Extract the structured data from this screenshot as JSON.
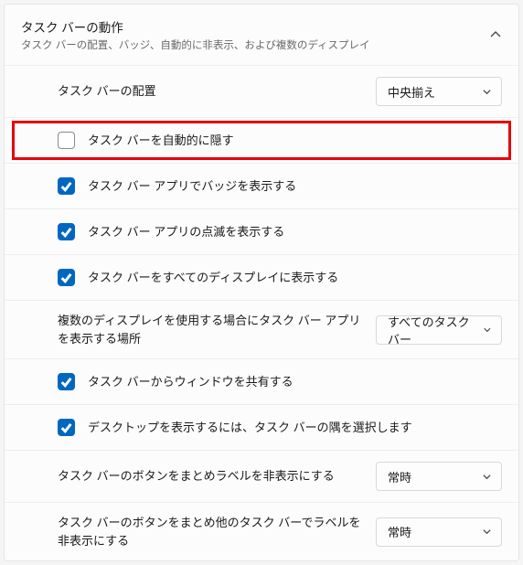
{
  "header": {
    "title": "タスク バーの動作",
    "subtitle": "タスク バーの配置、バッジ、自動的に非表示、および複数のディスプレイ"
  },
  "rows": {
    "alignment": {
      "label": "タスク バーの配置",
      "value": "中央揃え"
    },
    "autohide": {
      "label": "タスク バーを自動的に隠す"
    },
    "badges": {
      "label": "タスク バー アプリでバッジを表示する"
    },
    "flashing": {
      "label": "タスク バー アプリの点滅を表示する"
    },
    "alldisplays": {
      "label": "タスク バーをすべてのディスプレイに表示する"
    },
    "multidisplay": {
      "label": "複数のディスプレイを使用する場合にタスク バー アプリを表示する場所",
      "value": "すべてのタスク バー"
    },
    "sharewindow": {
      "label": "タスク バーからウィンドウを共有する"
    },
    "showdesktop": {
      "label": "デスクトップを表示するには、タスク バーの隅を選択します"
    },
    "combine_main": {
      "label": "タスク バーのボタンをまとめラベルを非表示にする",
      "value": "常時"
    },
    "combine_other": {
      "label": "タスク バーのボタンをまとめ他のタスク バーでラベルを非表示にする",
      "value": "常時"
    }
  }
}
